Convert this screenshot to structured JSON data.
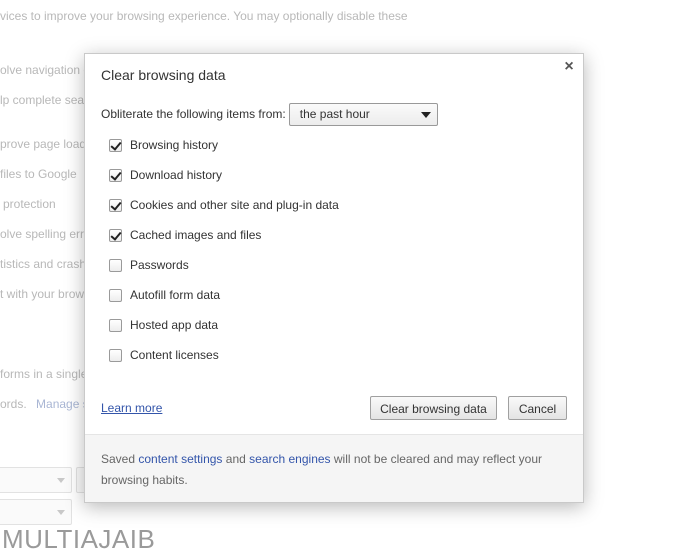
{
  "background": {
    "lines": [
      {
        "text": "vices to improve your browsing experience. You may optionally disable these",
        "link": ""
      },
      {
        "text": "olve navigation e",
        "link": ""
      },
      {
        "text": "lp complete sear",
        "link": ""
      },
      {
        "text": "prove page load",
        "link": ""
      },
      {
        "text": "files to Google",
        "link": ""
      },
      {
        "text": "protection",
        "link": ""
      },
      {
        "text": "olve spelling erro",
        "link": ""
      },
      {
        "text": "tistics and crash",
        "link": ""
      },
      {
        "text": "t with your brow",
        "link": ""
      },
      {
        "text": "forms in a single",
        "link": ""
      },
      {
        "text": "ords.",
        "link": "Manage s"
      }
    ]
  },
  "watermark": "MULTIAJAIB",
  "dialog": {
    "title": "Clear browsing data",
    "close_icon": "×",
    "time_range": {
      "label": "Obliterate the following items from:",
      "selected": "the past hour"
    },
    "items": [
      {
        "label": "Browsing history",
        "checked": true
      },
      {
        "label": "Download history",
        "checked": true
      },
      {
        "label": "Cookies and other site and plug-in data",
        "checked": true
      },
      {
        "label": "Cached images and files",
        "checked": true
      },
      {
        "label": "Passwords",
        "checked": false
      },
      {
        "label": "Autofill form data",
        "checked": false
      },
      {
        "label": "Hosted app data",
        "checked": false
      },
      {
        "label": "Content licenses",
        "checked": false
      }
    ],
    "learn_more": "Learn more",
    "clear_button": "Clear browsing data",
    "cancel_button": "Cancel",
    "footer": {
      "prefix": "Saved",
      "link1": "content settings",
      "middle": "and",
      "link2": "search engines",
      "suffix": "will not be cleared and may reflect your browsing habits."
    }
  },
  "colors": {
    "link": "#3355aa",
    "footer_bg": "#f5f5f5"
  }
}
